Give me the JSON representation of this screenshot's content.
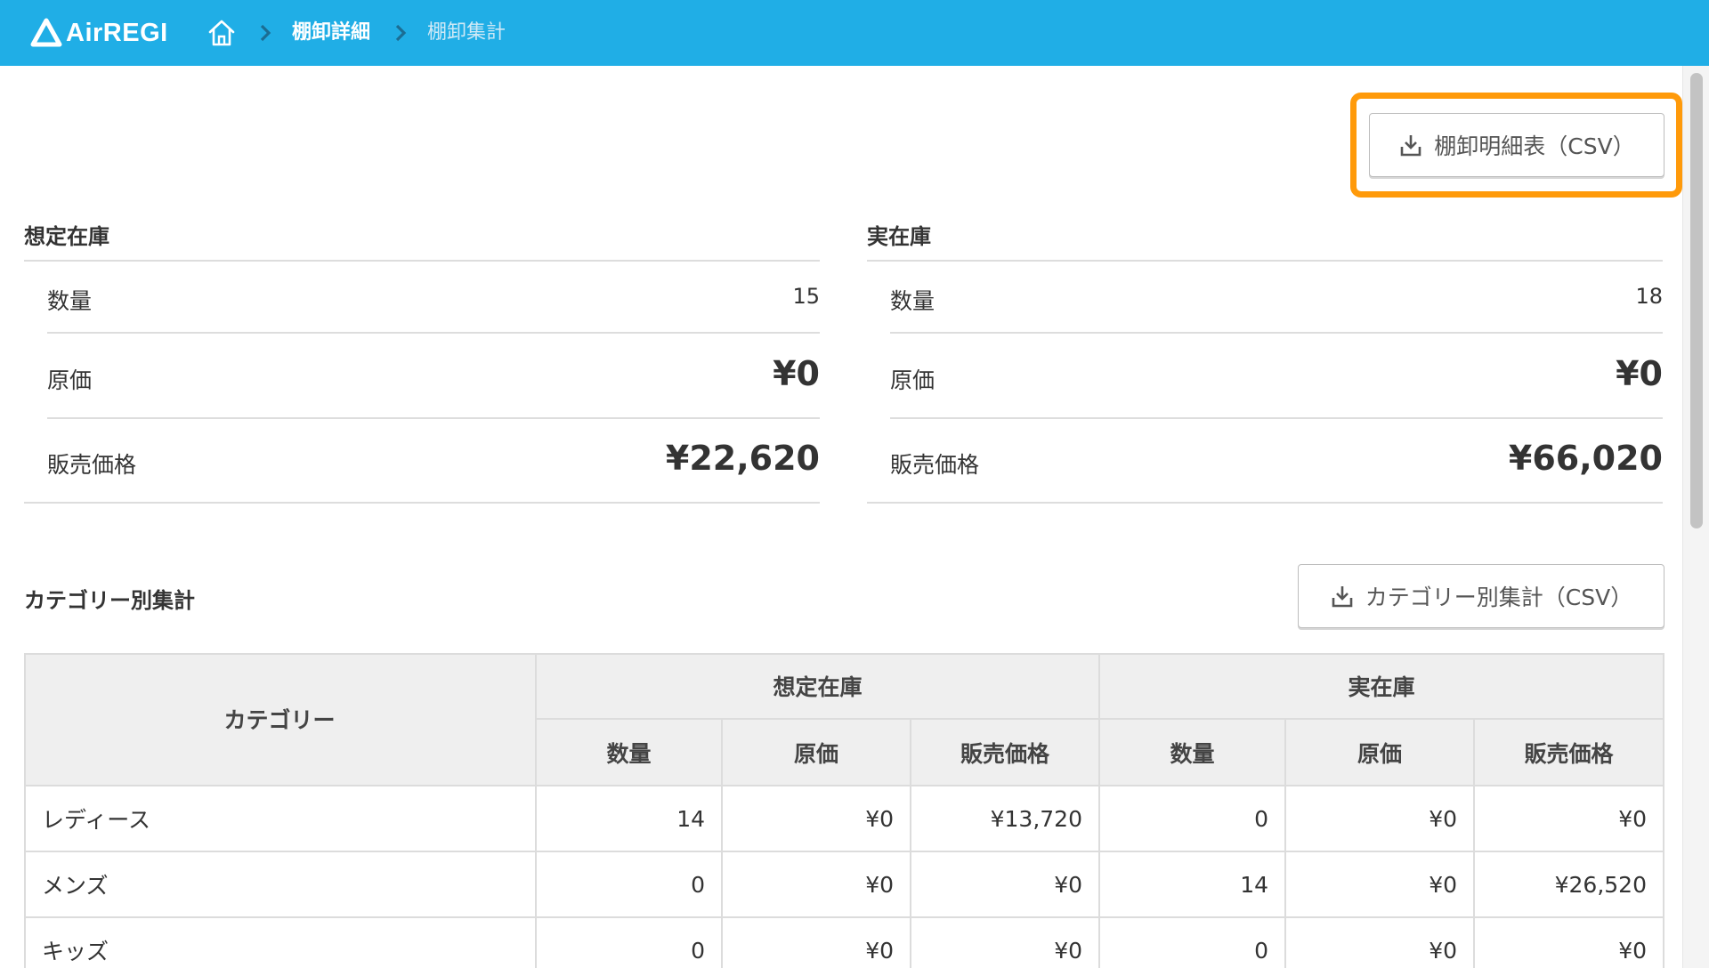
{
  "header": {
    "logo_text": "AirREGI",
    "breadcrumb": [
      "棚卸詳細",
      "棚卸集計"
    ]
  },
  "buttons": {
    "detail_csv": "棚卸明細表（CSV）",
    "category_csv": "カテゴリー別集計（CSV）"
  },
  "expected": {
    "title": "想定在庫",
    "rows": [
      {
        "label": "数量",
        "value": "15"
      },
      {
        "label": "原価",
        "value": "¥0"
      },
      {
        "label": "販売価格",
        "value": "¥22,620"
      }
    ]
  },
  "actual": {
    "title": "実在庫",
    "rows": [
      {
        "label": "数量",
        "value": "18"
      },
      {
        "label": "原価",
        "value": "¥0"
      },
      {
        "label": "販売価格",
        "value": "¥66,020"
      }
    ]
  },
  "category": {
    "title": "カテゴリー別集計",
    "table": {
      "col_category": "カテゴリー",
      "group_expected": "想定在庫",
      "group_actual": "実在庫",
      "sub_headers": [
        "数量",
        "原価",
        "販売価格",
        "数量",
        "原価",
        "販売価格"
      ],
      "rows": [
        {
          "name": "レディース",
          "cells": [
            "14",
            "¥0",
            "¥13,720",
            "0",
            "¥0",
            "¥0"
          ]
        },
        {
          "name": "メンズ",
          "cells": [
            "0",
            "¥0",
            "¥0",
            "14",
            "¥0",
            "¥26,520"
          ]
        },
        {
          "name": "キッズ",
          "cells": [
            "0",
            "¥0",
            "¥0",
            "0",
            "¥0",
            "¥0"
          ]
        }
      ]
    }
  },
  "colors": {
    "header_bg": "#20aee6",
    "highlight": "#ff9a0a"
  }
}
